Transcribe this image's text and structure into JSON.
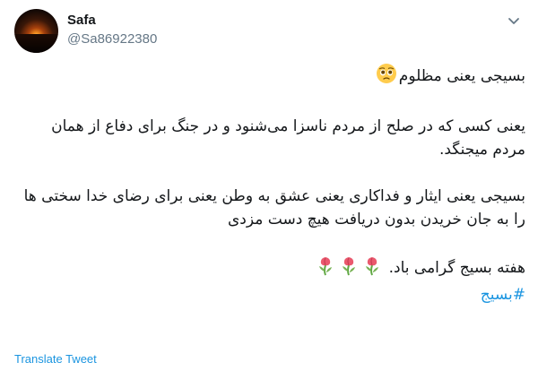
{
  "author": {
    "name": "Safa",
    "handle": "@Sa86922380"
  },
  "tweet": {
    "line1": "بسیجی یعنی مظلوم",
    "para2": "یعنی کسی که در صلح از مردم ناسزا می‌شنود و در جنگ برای دفاع از همان مردم میجنگد.",
    "para3": "بسیجی یعنی ایثار و فداکاری یعنی عشق به وطن یعنی برای رضای خدا سختی ها را به جان خریدن بدون دریافت هیچ دست مزدی",
    "para4": "هفته بسیج گرامی باد.",
    "hashtag": "#بسیج"
  },
  "icons": {
    "face": "pleading-face-icon",
    "flower": "wilted-flower-icon",
    "menu": "chevron-down-icon"
  },
  "footer": {
    "translate_label": "Translate Tweet"
  },
  "colors": {
    "link": "#1b95e0",
    "handle": "#657786",
    "text": "#14171a"
  }
}
